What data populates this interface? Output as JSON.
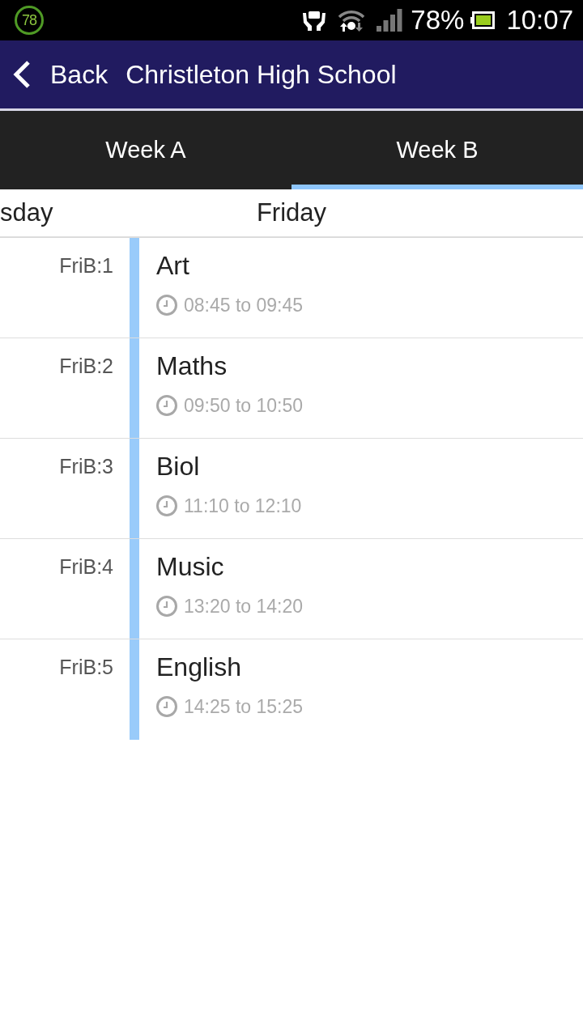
{
  "status_bar": {
    "badge": "78",
    "battery": "78%",
    "time": "10:07"
  },
  "app_bar": {
    "back": "Back",
    "title": "Christleton High School"
  },
  "tabs": [
    {
      "label": "Week A",
      "selected": false
    },
    {
      "label": "Week B",
      "selected": true
    }
  ],
  "day_strip": {
    "previous": "sday",
    "current": "Friday"
  },
  "periods": [
    {
      "label": "FriB:1",
      "subject": "Art",
      "time": "08:45 to 09:45"
    },
    {
      "label": "FriB:2",
      "subject": "Maths",
      "time": "09:50 to 10:50"
    },
    {
      "label": "FriB:3",
      "subject": "Biol",
      "time": "11:10 to 12:10"
    },
    {
      "label": "FriB:4",
      "subject": "Music",
      "time": "13:20 to 14:20"
    },
    {
      "label": "FriB:5",
      "subject": "English",
      "time": "14:25 to 15:25"
    }
  ]
}
